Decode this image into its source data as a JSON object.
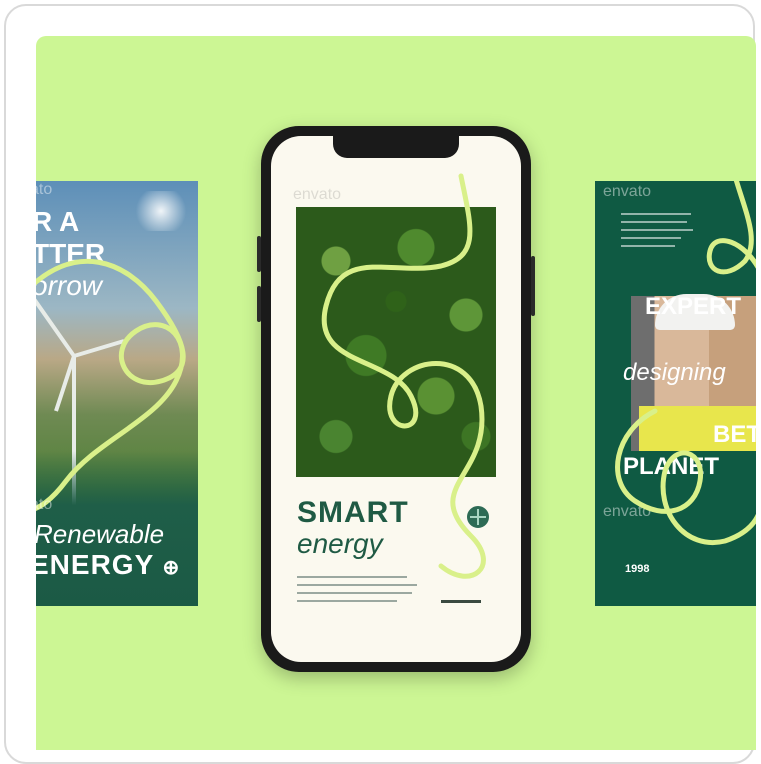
{
  "left_story": {
    "headline_line1": "R A",
    "headline_line2": "TTER",
    "headline_line3": "orrow",
    "watermark_top": "ato",
    "watermark_bottom": "ato",
    "renewable": "Renewable",
    "energy": "ENERGY"
  },
  "phone": {
    "watermark": "envato",
    "title": "SMART",
    "subtitle": "energy"
  },
  "right_story": {
    "watermark_top": "envato",
    "watermark_bottom": "envato",
    "expert": "EXPERT",
    "designing": "designing",
    "bet": "BET",
    "planet": "PLANET",
    "year": "1998"
  },
  "colors": {
    "background": "#ccf694",
    "accent_line": "#d9f08a",
    "dark_green": "#0f5a43",
    "phone_frame": "#1a1a1a",
    "phone_screen": "#fbf9ef"
  }
}
